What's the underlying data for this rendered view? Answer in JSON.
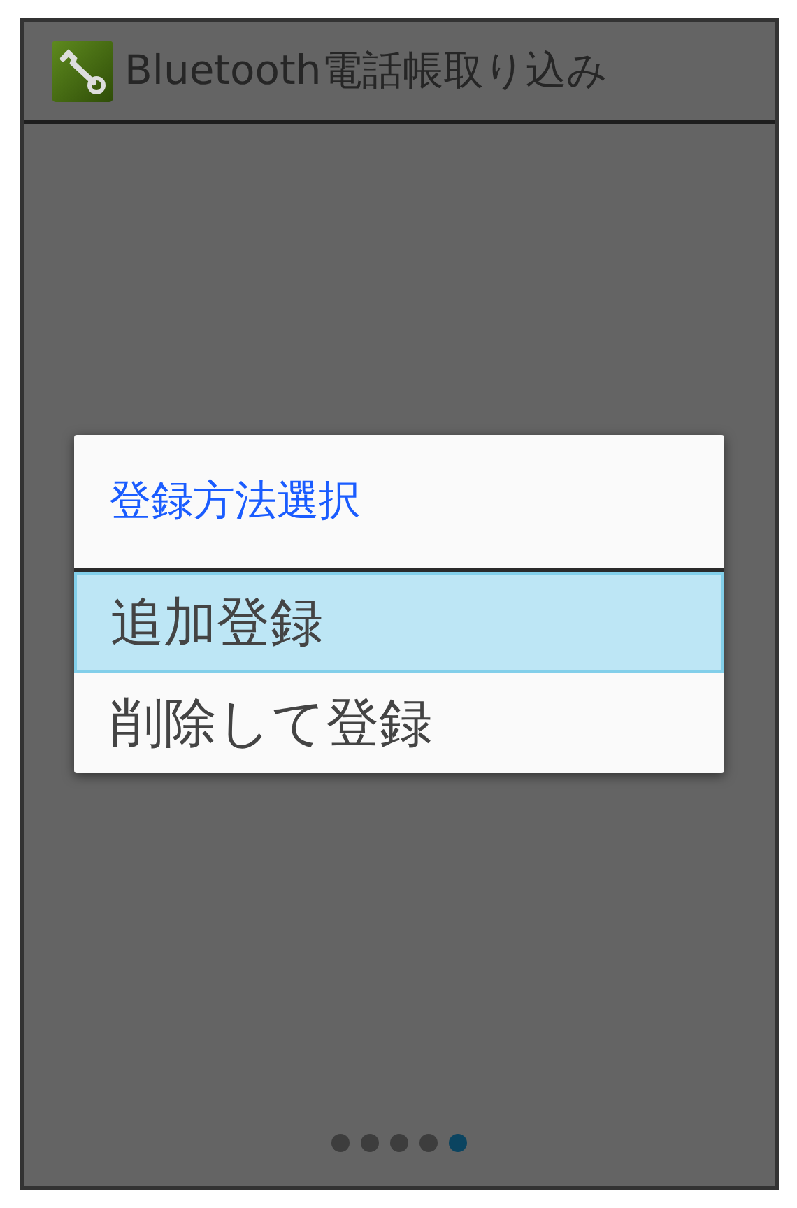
{
  "app_bar": {
    "title": "Bluetooth電話帳取り込み"
  },
  "dialog": {
    "title": "登録方法選択",
    "items": [
      {
        "label": "追加登録",
        "selected": true
      },
      {
        "label": "削除して登録",
        "selected": false
      }
    ]
  },
  "page_indicator": [
    {
      "selected": false
    },
    {
      "selected": false
    },
    {
      "selected": false
    },
    {
      "selected": false
    },
    {
      "selected": true
    }
  ]
}
